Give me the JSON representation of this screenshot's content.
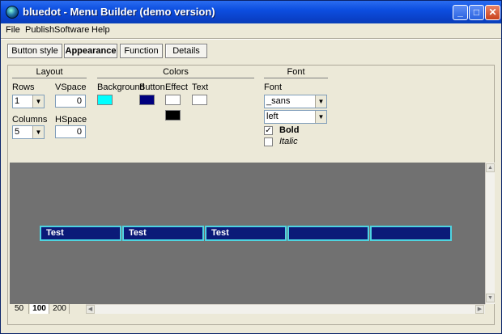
{
  "window": {
    "title": "bluedot - Menu Builder (demo version)",
    "minimize": "_",
    "maximize": "□",
    "close": "✕"
  },
  "menu": [
    "File",
    "Publish",
    "Software",
    "Help"
  ],
  "tabs": [
    {
      "label": "Button style",
      "active": false
    },
    {
      "label": "Appearance",
      "active": true
    },
    {
      "label": "Function",
      "active": false
    },
    {
      "label": "Details",
      "active": false
    }
  ],
  "layout": {
    "title": "Layout",
    "rows_label": "Rows",
    "rows_value": "1",
    "vspace_label": "VSpace",
    "vspace_value": "0",
    "columns_label": "Columns",
    "columns_value": "5",
    "hspace_label": "HSpace",
    "hspace_value": "0"
  },
  "colors": {
    "title": "Colors",
    "background_label": "Background",
    "background_color": "#00ffff",
    "button_label": "Button",
    "button_color": "#00007f",
    "effect_label": "Effect",
    "effect_color": "#ffffff",
    "effect_color2": "#000000",
    "text_label": "Text",
    "text_color": "#ffffff"
  },
  "font": {
    "title": "Font",
    "font_label": "Font",
    "family_value": "_sans",
    "align_value": "left",
    "bold_label": "Bold",
    "bold_checked": "✓",
    "italic_label": "Italic"
  },
  "preview": {
    "buttons": [
      "Test",
      "Test",
      "Test",
      "",
      ""
    ]
  },
  "zoom": [
    "50",
    "100",
    "200"
  ]
}
